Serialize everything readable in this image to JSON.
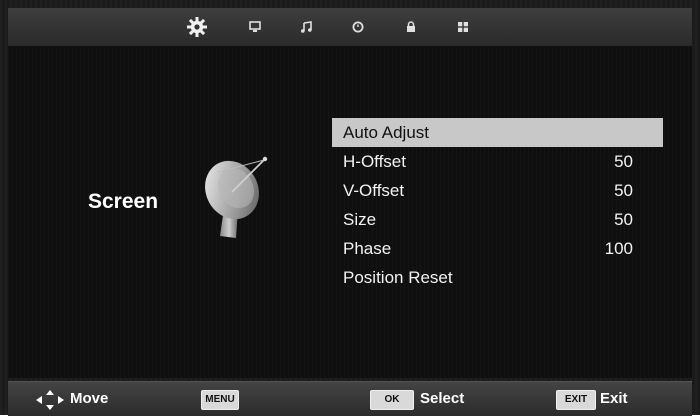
{
  "topbar": {
    "icons": [
      {
        "name": "picture-settings-gear-icon",
        "active": true
      },
      {
        "name": "monitor-icon",
        "active": false
      },
      {
        "name": "music-note-icon",
        "active": false
      },
      {
        "name": "clock-icon",
        "active": false
      },
      {
        "name": "lock-icon",
        "active": false
      },
      {
        "name": "setup-grid-icon",
        "active": false
      }
    ]
  },
  "section": {
    "title": "Screen",
    "image_icon": "satellite-dish-icon"
  },
  "menu": {
    "items": [
      {
        "label": "Auto Adjust",
        "value": "",
        "selected": true
      },
      {
        "label": "H-Offset",
        "value": "50",
        "selected": false
      },
      {
        "label": "V-Offset",
        "value": "50",
        "selected": false
      },
      {
        "label": "Size",
        "value": "50",
        "selected": false
      },
      {
        "label": "Phase",
        "value": "100",
        "selected": false
      },
      {
        "label": "Position Reset",
        "value": "",
        "selected": false
      }
    ]
  },
  "bottombar": {
    "move_label": "Move",
    "menu_key": "MENU",
    "ok_key": "OK",
    "select_label": "Select",
    "exit_key": "EXIT",
    "exit_label": "Exit"
  },
  "colors": {
    "selected_row_bg": "#c8c8c8",
    "background": "#111111",
    "text": "#ffffff"
  }
}
